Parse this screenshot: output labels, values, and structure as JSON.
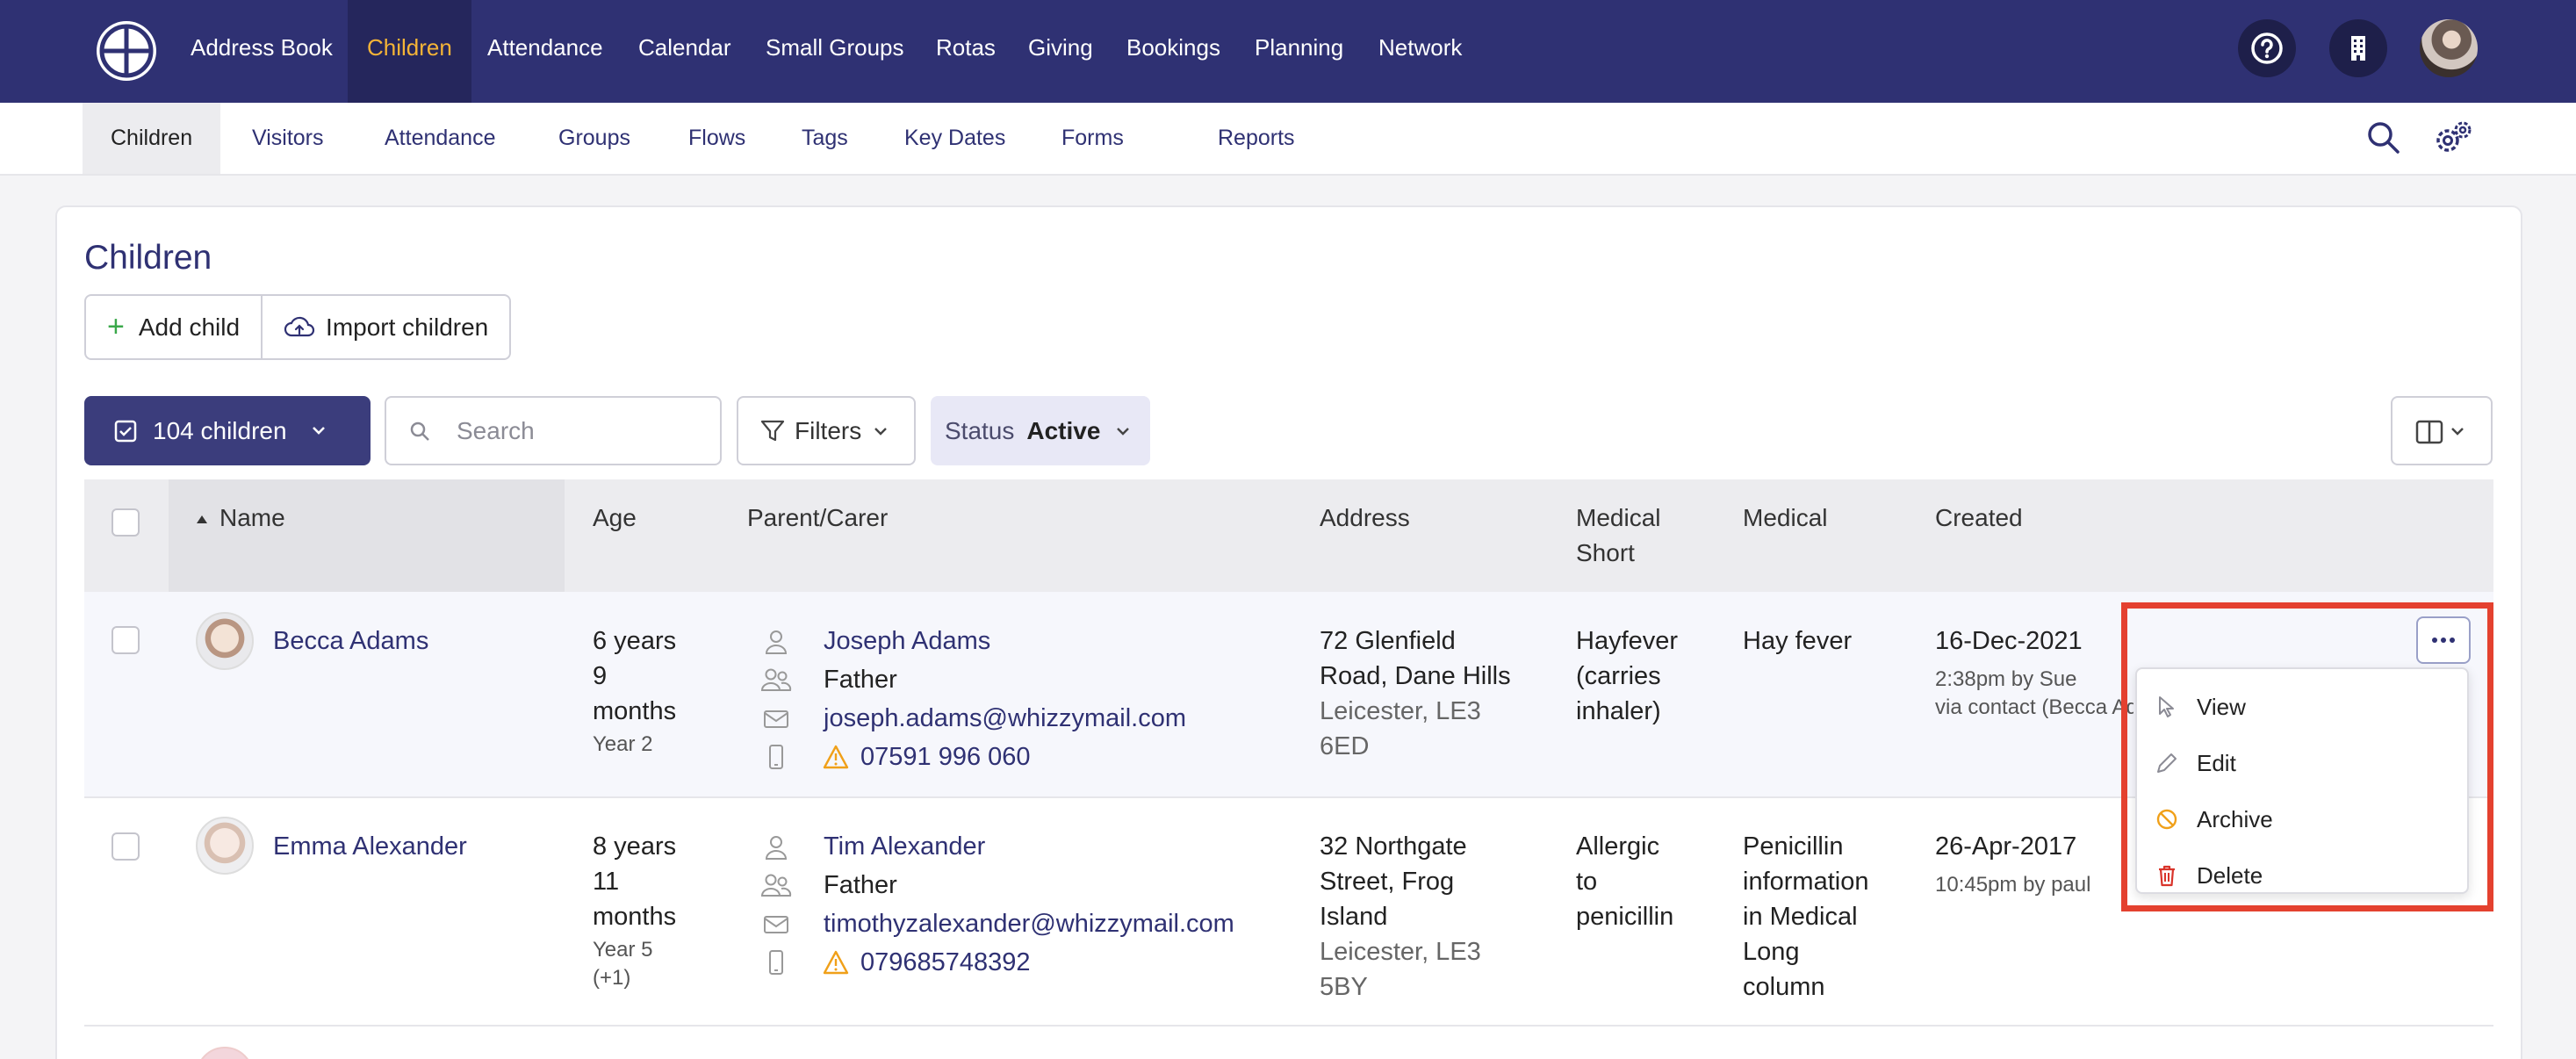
{
  "top_nav": {
    "items": [
      "Address Book",
      "Children",
      "Attendance",
      "Calendar",
      "Small Groups",
      "Rotas",
      "Giving",
      "Bookings",
      "Planning",
      "Network"
    ],
    "active": "Children"
  },
  "sub_nav": {
    "items": [
      "Children",
      "Visitors",
      "Attendance",
      "Groups",
      "Flows",
      "Tags",
      "Key Dates",
      "Forms",
      "Reports"
    ],
    "active": "Children"
  },
  "page": {
    "title": "Children",
    "add_child": "Add child",
    "import_children": "Import children"
  },
  "toolbar": {
    "count_label": "104 children",
    "search_placeholder": "Search",
    "filters_label": "Filters",
    "status_label": "Status",
    "status_value": "Active"
  },
  "table": {
    "headers": {
      "name": "Name",
      "age": "Age",
      "parent": "Parent/Carer",
      "address": "Address",
      "medical_short_1": "Medical",
      "medical_short_2": "Short",
      "medical": "Medical",
      "created": "Created"
    },
    "rows": [
      {
        "name": "Becca Adams",
        "age": [
          "6 years",
          "9",
          "months"
        ],
        "year": "Year 2",
        "year_extra": "",
        "parent_name": "Joseph Adams",
        "relation": "Father",
        "email": "joseph.adams@whizzymail.com",
        "phone": "07591 996 060",
        "address": [
          "72 Glenfield",
          "Road, Dane Hills"
        ],
        "address_grey": [
          "Leicester, LE3",
          "6ED"
        ],
        "medical_short": [
          "Hayfever",
          "(carries",
          "inhaler)"
        ],
        "medical": [
          "Hay fever"
        ],
        "created_date": "16-Dec-2021",
        "created_by": "2:38pm by Sue",
        "created_via": "via contact (Becca Ad"
      },
      {
        "name": "Emma Alexander",
        "age": [
          "8 years",
          "11",
          "months"
        ],
        "year": "Year 5",
        "year_extra": "(+1)",
        "parent_name": "Tim Alexander",
        "relation": "Father",
        "email": "timothyzalexander@whizzymail.com",
        "phone": "079685748392",
        "address": [
          "32 Northgate",
          "Street, Frog",
          "Island"
        ],
        "address_grey": [
          "Leicester, LE3",
          "5BY"
        ],
        "medical_short": [
          "Allergic",
          "to",
          "penicillin"
        ],
        "medical": [
          "Penicillin",
          "information",
          "in Medical",
          "Long",
          "column"
        ],
        "created_date": "26-Apr-2017",
        "created_by": "10:45pm by paul",
        "created_via": ""
      }
    ]
  },
  "row_menu": {
    "items": [
      "View",
      "Edit",
      "Archive",
      "Delete"
    ]
  },
  "colors": {
    "nav_bg": "#2f3173",
    "nav_active": "#f5b437",
    "link": "#2f3173",
    "highlight": "#e4412f",
    "warning": "#f0a019",
    "delete": "#d9342b"
  }
}
